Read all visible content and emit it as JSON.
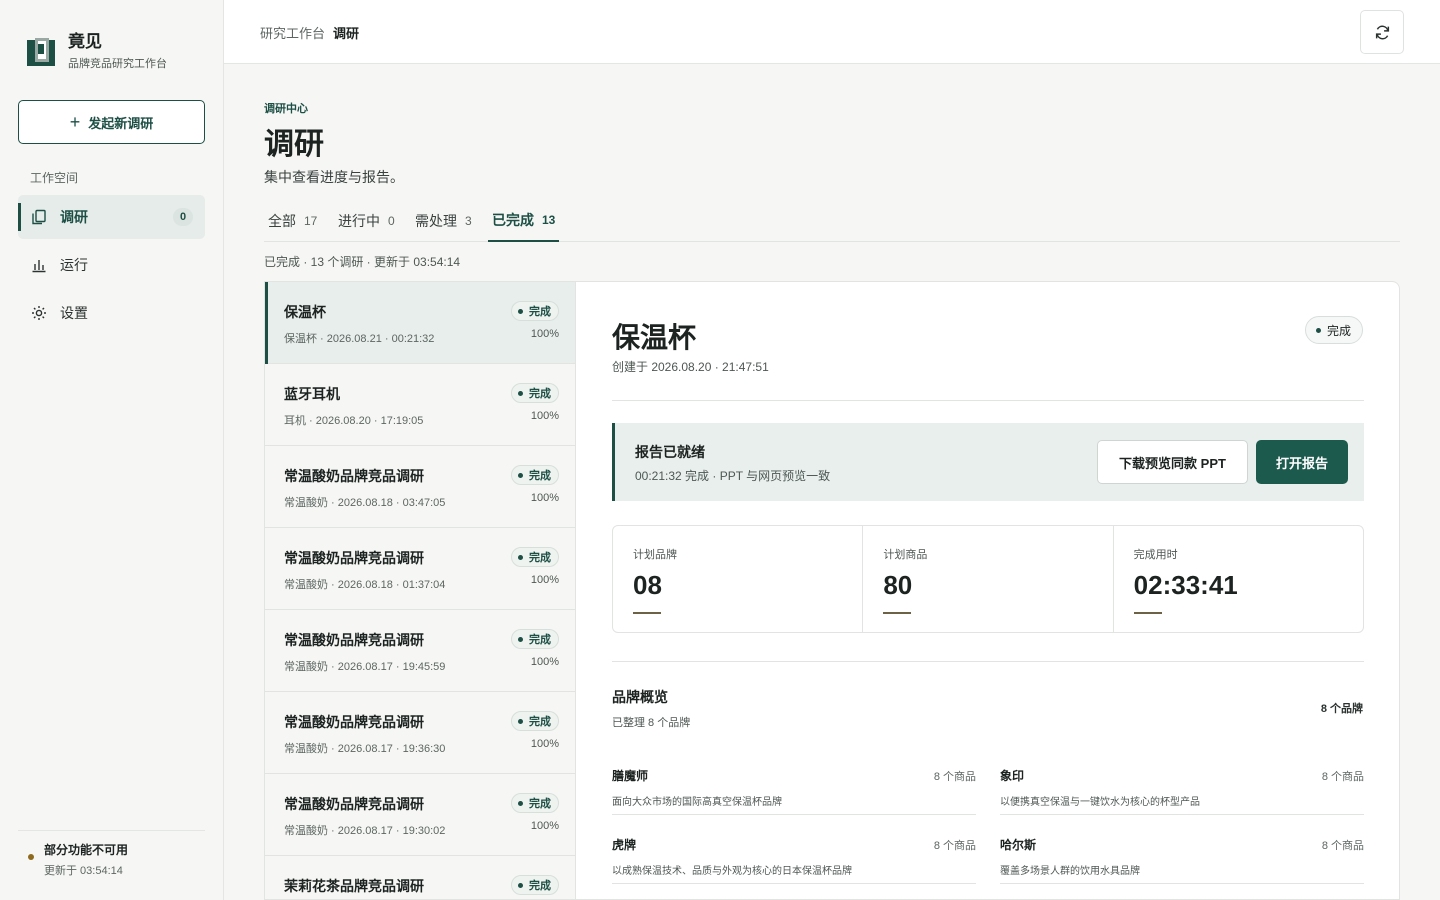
{
  "app": {
    "name": "竟见",
    "subtitle": "品牌竞品研究工作台",
    "new_button": "发起新调研"
  },
  "sidebar": {
    "section_label": "工作空间",
    "items": [
      {
        "label": "调研",
        "icon": "copy-icon",
        "badge": "0",
        "active": true
      },
      {
        "label": "运行",
        "icon": "bar-chart-icon",
        "active": false
      },
      {
        "label": "设置",
        "icon": "sun-gear-icon",
        "active": false
      }
    ],
    "footer": {
      "title": "部分功能不可用",
      "subtitle": "更新于 03:54:14"
    }
  },
  "topbar": {
    "breadcrumb_parent": "研究工作台",
    "breadcrumb_current": "调研",
    "refresh_icon": "refresh-icon"
  },
  "header": {
    "eyebrow": "调研中心",
    "title": "调研",
    "description": "集中查看进度与报告。"
  },
  "tabs": [
    {
      "label": "全部",
      "count": "17",
      "active": false
    },
    {
      "label": "进行中",
      "count": "0",
      "active": false
    },
    {
      "label": "需处理",
      "count": "3",
      "active": false
    },
    {
      "label": "已完成",
      "count": "13",
      "active": true
    }
  ],
  "meta_line": "已完成 · 13 个调研 · 更新于 03:54:14",
  "list": [
    {
      "title": "保温杯",
      "sub": "保温杯 · 2026.08.21 · 00:21:32",
      "status": "完成",
      "progress": "100%",
      "selected": true
    },
    {
      "title": "蓝牙耳机",
      "sub": "耳机 · 2026.08.20 · 17:19:05",
      "status": "完成",
      "progress": "100%"
    },
    {
      "title": "常温酸奶品牌竞品调研",
      "sub": "常温酸奶 · 2026.08.18 · 03:47:05",
      "status": "完成",
      "progress": "100%"
    },
    {
      "title": "常温酸奶品牌竞品调研",
      "sub": "常温酸奶 · 2026.08.18 · 01:37:04",
      "status": "完成",
      "progress": "100%"
    },
    {
      "title": "常温酸奶品牌竞品调研",
      "sub": "常温酸奶 · 2026.08.17 · 19:45:59",
      "status": "完成",
      "progress": "100%"
    },
    {
      "title": "常温酸奶品牌竞品调研",
      "sub": "常温酸奶 · 2026.08.17 · 19:36:30",
      "status": "完成",
      "progress": "100%"
    },
    {
      "title": "常温酸奶品牌竞品调研",
      "sub": "常温酸奶 · 2026.08.17 · 19:30:02",
      "status": "完成",
      "progress": "100%"
    },
    {
      "title": "茉莉花茶品牌竞品调研",
      "sub": "",
      "status": "完成",
      "progress": ""
    }
  ],
  "detail": {
    "title": "保温杯",
    "created": "创建于 2026.08.20 · 21:47:51",
    "status": "完成",
    "report": {
      "title": "报告已就绪",
      "sub": "00:21:32 完成 · PPT 与网页预览一致",
      "download_button": "下载预览同款 PPT",
      "open_button": "打开报告"
    },
    "stats": [
      {
        "label": "计划品牌",
        "value": "08"
      },
      {
        "label": "计划商品",
        "value": "80"
      },
      {
        "label": "完成用时",
        "value": "02:33:41"
      }
    ],
    "overview": {
      "title": "品牌概览",
      "sub": "已整理 8 个品牌",
      "count": "8 个品牌",
      "brands": [
        {
          "name": "膳魔师",
          "count": "8 个商品",
          "desc": "面向大众市场的国际高真空保温杯品牌"
        },
        {
          "name": "象印",
          "count": "8 个商品",
          "desc": "以便携真空保温与一键饮水为核心的杯型产品"
        },
        {
          "name": "虎牌",
          "count": "8 个商品",
          "desc": "以成熟保温技术、品质与外观为核心的日本保温杯品牌"
        },
        {
          "name": "哈尔斯",
          "count": "8 个商品",
          "desc": "覆盖多场景人群的饮用水具品牌"
        }
      ]
    }
  }
}
